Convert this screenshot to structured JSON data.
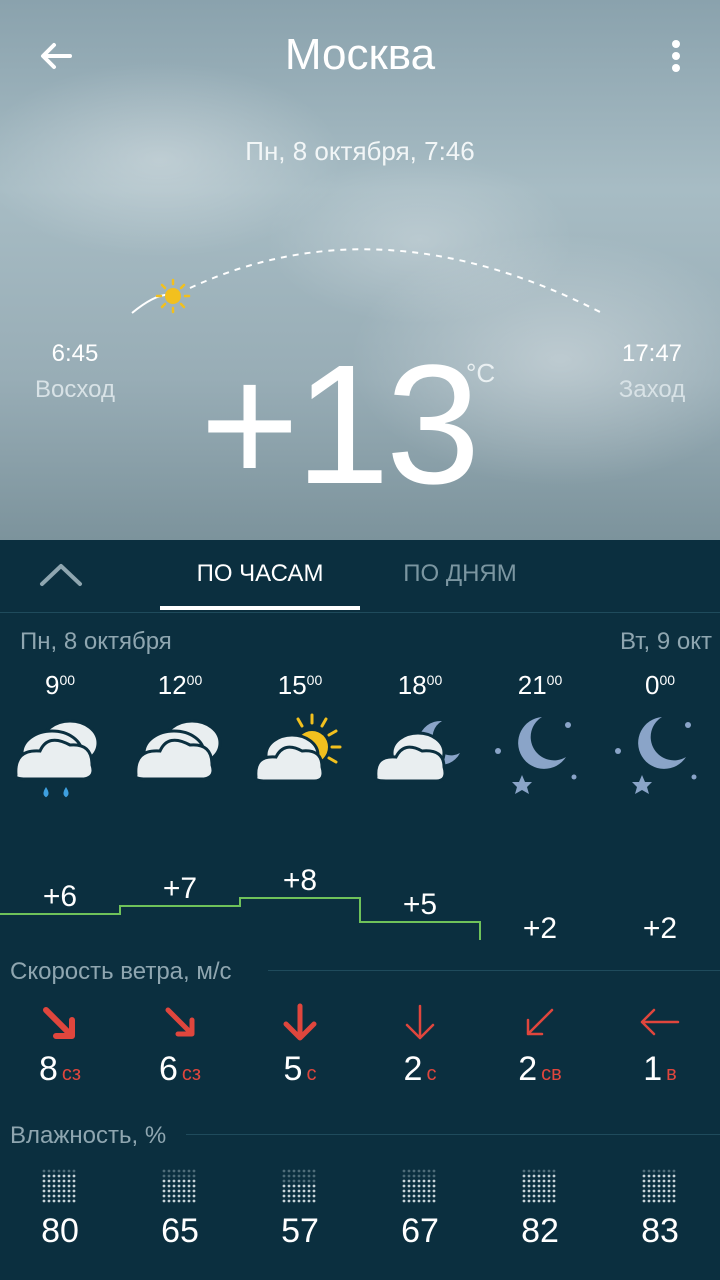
{
  "header": {
    "title": "Москва",
    "date": "Пн, 8 октября, 7:46"
  },
  "sun": {
    "sunrise_time": "6:45",
    "sunrise_label": "Восход",
    "sunset_time": "17:47",
    "sunset_label": "Заход"
  },
  "current": {
    "temp": "+13",
    "unit": "°C"
  },
  "tabs": {
    "hourly": "ПО ЧАСАМ",
    "daily": "ПО ДНЯМ"
  },
  "days": {
    "today": "Пн, 8 октября",
    "tomorrow": "Вт, 9 окт"
  },
  "hours": [
    {
      "h": "9",
      "m": "00",
      "icon": "cloud-rain-icon",
      "temp": "+6"
    },
    {
      "h": "12",
      "m": "00",
      "icon": "clouds-icon",
      "temp": "+7"
    },
    {
      "h": "15",
      "m": "00",
      "icon": "partly-sunny-icon",
      "temp": "+8"
    },
    {
      "h": "18",
      "m": "00",
      "icon": "partly-cloudy-night-icon",
      "temp": "+5"
    },
    {
      "h": "21",
      "m": "00",
      "icon": "clear-night-icon",
      "temp": "+2"
    },
    {
      "h": "0",
      "m": "00",
      "icon": "clear-night-icon",
      "temp": "+2"
    }
  ],
  "temp_values": [
    6,
    7,
    8,
    5,
    2,
    2
  ],
  "wind": {
    "title": "Скорость ветра, м/с",
    "items": [
      {
        "speed": "8",
        "dir": "сз"
      },
      {
        "speed": "6",
        "dir": "сз"
      },
      {
        "speed": "5",
        "dir": "с"
      },
      {
        "speed": "2",
        "dir": "с"
      },
      {
        "speed": "2",
        "dir": "св"
      },
      {
        "speed": "1",
        "dir": "в"
      }
    ]
  },
  "humidity": {
    "title": "Влажность, %",
    "values": [
      "80",
      "65",
      "57",
      "67",
      "82",
      "83"
    ]
  },
  "colors": {
    "panel_bg": "#0b2f3f",
    "temp_line": "#6fc25a",
    "wind_arrow": "#e0463d",
    "secondary_text": "#8fa6b0"
  }
}
